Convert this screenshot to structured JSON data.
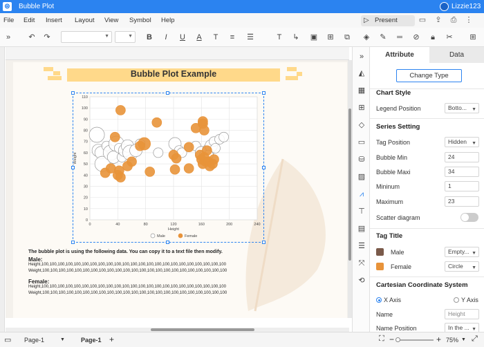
{
  "app": {
    "title": "Bubble Plot",
    "user": "Lizzie123"
  },
  "menu": [
    "File",
    "Edit",
    "Insert",
    "Layout",
    "View",
    "Symbol",
    "Help"
  ],
  "present_label": "Present",
  "panel": {
    "tabs": [
      "Attribute",
      "Data"
    ],
    "change_type": "Change Type",
    "chart_style": "Chart Style",
    "legend_position_label": "Legend Position",
    "legend_position_value": "Botto...",
    "series_setting": "Series Setting",
    "tag_position_label": "Tag Position",
    "tag_position_value": "Hidden",
    "bubble_min_label": "Bubble Min",
    "bubble_min_value": "24",
    "bubble_maxi_label": "Bubble Maxi",
    "bubble_maxi_value": "34",
    "minimum_label": "Mininum",
    "minimum_value": "1",
    "maximum_label": "Maximum",
    "maximum_value": "23",
    "scatter_label": "Scatter diagram",
    "tag_title": "Tag Title",
    "male_label": "Male",
    "male_value": "Empty...",
    "female_label": "Female",
    "female_value": "Circle",
    "cartesian": "Cartesian Coordinate System",
    "x_axis": "X Axis",
    "y_axis": "Y Axis",
    "name_label": "Name",
    "name_placeholder": "Height",
    "name_position_label": "Name Position",
    "name_position_value": "In the ...",
    "colors": {
      "male": "#7a5a4a",
      "female": "#e8933a"
    }
  },
  "status": {
    "page_select": "Page-1",
    "page_tab": "Page-1",
    "zoom": "75%"
  },
  "document": {
    "heading": "Bubble Plot Example",
    "intro": "The bubble plot is using the following data. You can copy it to a text file then modify.",
    "male_heading": "Male:",
    "male_height": "Height,100,100,100,100,100,100,100,100,100,100,100,100,100,100,100,100,100,100,100,100,100,100,100",
    "male_weight": "Weight,100,100,100,100,100,100,100,100,100,100,100,100,100,100,100,100,100,100,100,100,100,100,100",
    "female_heading": "Female:",
    "female_height": "Height,100,100,100,100,100,100,100,100,100,100,100,100,100,100,100,100,100,100,100,100,100,100,100",
    "female_weight": "Weight,100,100,100,100,100,100,100,100,100,100,100,100,100,100,100,100,100,100,100,100,100,100,100"
  },
  "chart_data": {
    "type": "scatter",
    "title": "",
    "xlabel": "Height",
    "ylabel": "Weight",
    "xlim": [
      0,
      240
    ],
    "ylim": [
      0,
      110
    ],
    "xticks": [
      "0",
      "40",
      "80",
      "120",
      "160",
      "200",
      "240"
    ],
    "yticks": [
      "0",
      "10",
      "20",
      "30",
      "40",
      "50",
      "60",
      "70",
      "80",
      "90",
      "100",
      "110"
    ],
    "grid": true,
    "legend": "bottom",
    "series": [
      {
        "name": "Male",
        "color": "#ffffff",
        "stroke": "#999999",
        "points": [
          [
            10,
            76,
            4
          ],
          [
            12,
            62,
            3
          ],
          [
            16,
            60,
            3
          ],
          [
            18,
            50,
            4
          ],
          [
            24,
            66,
            2
          ],
          [
            30,
            60,
            4
          ],
          [
            34,
            56,
            3
          ],
          [
            38,
            68,
            4
          ],
          [
            42,
            64,
            2
          ],
          [
            46,
            56,
            2
          ],
          [
            50,
            62,
            3
          ],
          [
            54,
            66,
            3
          ],
          [
            58,
            60,
            4
          ],
          [
            66,
            62,
            3
          ],
          [
            72,
            68,
            2
          ],
          [
            98,
            60,
            2
          ],
          [
            122,
            68,
            3
          ],
          [
            128,
            62,
            2
          ],
          [
            132,
            60,
            2
          ],
          [
            152,
            66,
            2
          ],
          [
            160,
            60,
            3
          ],
          [
            164,
            58,
            2
          ],
          [
            166,
            54,
            2
          ],
          [
            170,
            62,
            3
          ],
          [
            174,
            66,
            3
          ],
          [
            178,
            70,
            2
          ],
          [
            180,
            64,
            2
          ],
          [
            186,
            72,
            2
          ],
          [
            192,
            74,
            2
          ],
          [
            170,
            58,
            2
          ]
        ]
      },
      {
        "name": "Female",
        "color": "#e8933a",
        "stroke": "#e8933a",
        "points": [
          [
            22,
            42,
            2
          ],
          [
            30,
            46,
            2
          ],
          [
            36,
            74,
            2
          ],
          [
            40,
            40,
            2
          ],
          [
            42,
            44,
            2
          ],
          [
            44,
            38,
            2
          ],
          [
            44,
            98,
            2
          ],
          [
            54,
            48,
            2
          ],
          [
            60,
            52,
            2
          ],
          [
            72,
            66,
            2
          ],
          [
            78,
            68,
            3
          ],
          [
            86,
            43,
            2
          ],
          [
            96,
            87,
            2
          ],
          [
            120,
            58,
            2
          ],
          [
            122,
            45,
            2
          ],
          [
            124,
            55,
            2
          ],
          [
            142,
            46,
            2
          ],
          [
            142,
            65,
            2
          ],
          [
            152,
            82,
            2
          ],
          [
            162,
            86,
            2
          ],
          [
            162,
            88,
            2
          ],
          [
            164,
            80,
            2
          ],
          [
            158,
            58,
            2
          ],
          [
            160,
            54,
            2
          ],
          [
            162,
            50,
            2
          ],
          [
            164,
            56,
            2
          ],
          [
            166,
            52,
            2
          ],
          [
            170,
            52,
            2
          ],
          [
            172,
            48,
            2
          ],
          [
            176,
            50,
            2
          ],
          [
            168,
            62,
            2
          ],
          [
            178,
            54,
            2
          ]
        ]
      }
    ]
  }
}
